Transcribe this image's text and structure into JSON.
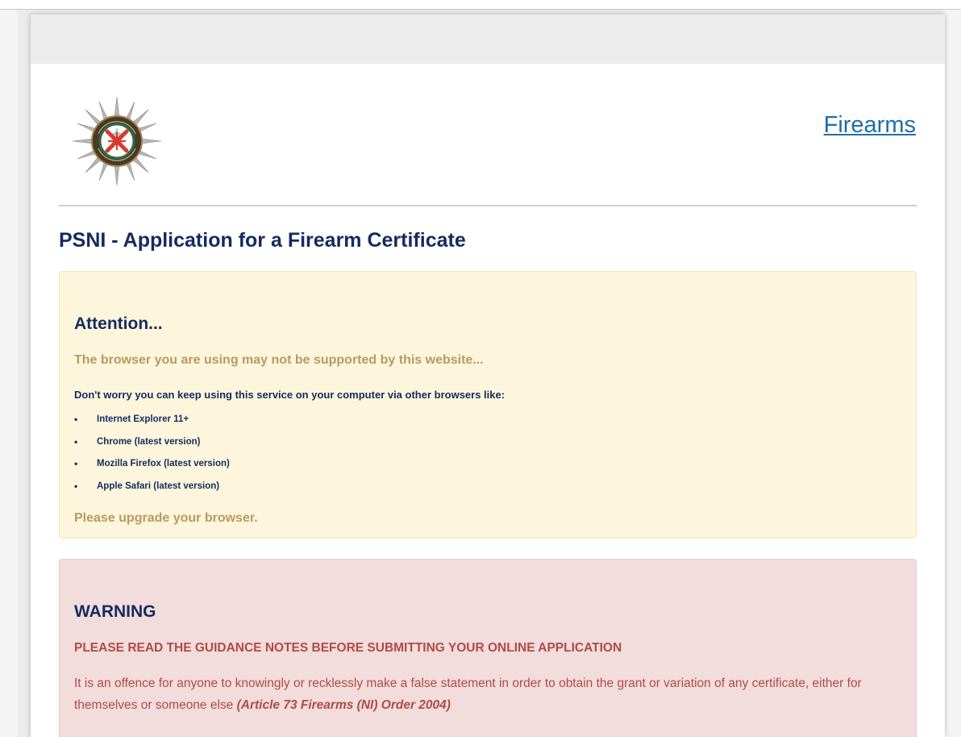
{
  "header": {
    "logo_name": "psni-crest",
    "nav_link": "Firearms"
  },
  "page": {
    "title": "PSNI - Application for a Firearm Certificate"
  },
  "attention": {
    "heading": "Attention...",
    "lead": "The browser you are using may not be supported by this website...",
    "intro": "Don't worry you can keep using this service on your computer via other browsers like:",
    "browsers": [
      "Internet Explorer 11+",
      "Chrome (latest version)",
      "Mozilla Firefox (latest version)",
      "Apple Safari (latest version)"
    ],
    "footer": "Please upgrade your browser."
  },
  "warning": {
    "heading": "WARNING",
    "lead": "PLEASE READ THE GUIDANCE NOTES BEFORE SUBMITTING YOUR ONLINE APPLICATION",
    "text": "It is an offence for anyone to knowingly or recklessly make a false statement in order to obtain the grant or variation of any certificate, either for themselves or someone else ",
    "citation": "(Article 73 Firearms (NI) Order 2004)"
  },
  "colors": {
    "title": "#142b5f",
    "link": "#1f6fa7",
    "attention_bg": "#fdf6dd",
    "attention_text": "#b89b5d",
    "warning_bg": "#f2dcdc",
    "warning_text": "#b04b45"
  }
}
